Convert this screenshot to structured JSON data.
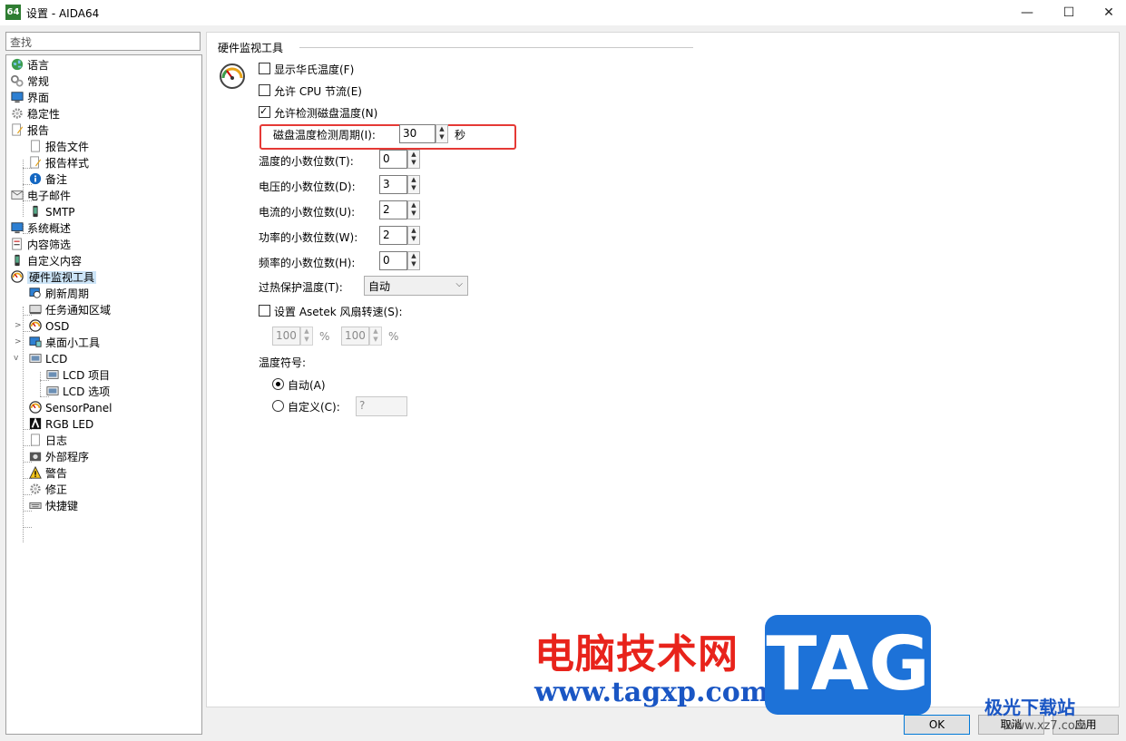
{
  "window": {
    "app_icon_text": "64",
    "title": "设置 - AIDA64",
    "minimize": "—",
    "maximize": "☐",
    "close": "✕"
  },
  "search": {
    "value": "查找"
  },
  "tree": [
    {
      "label": "语言",
      "icon": "globe-icon"
    },
    {
      "label": "常规",
      "icon": "gears-icon"
    },
    {
      "label": "界面",
      "icon": "monitor-icon"
    },
    {
      "label": "稳定性",
      "icon": "gear-icon"
    },
    {
      "label": "报告",
      "icon": "report-icon"
    },
    {
      "label": "报告文件",
      "icon": "document-icon"
    },
    {
      "label": "报告样式",
      "icon": "report-style-icon"
    },
    {
      "label": "备注",
      "icon": "info-icon"
    },
    {
      "label": "电子邮件",
      "icon": "email-icon"
    },
    {
      "label": "SMTP",
      "icon": "phone-icon"
    },
    {
      "label": "系统概述",
      "icon": "monitor-icon"
    },
    {
      "label": "内容筛选",
      "icon": "filter-icon"
    },
    {
      "label": "自定义内容",
      "icon": "phone-icon"
    },
    {
      "label": "硬件监视工具",
      "icon": "gauge-icon"
    },
    {
      "label": "刷新周期",
      "icon": "refresh-icon"
    },
    {
      "label": "任务通知区域",
      "icon": "taskbar-icon"
    },
    {
      "label": "OSD",
      "icon": "gauge-icon"
    },
    {
      "label": "桌面小工具",
      "icon": "gadget-icon"
    },
    {
      "label": "LCD",
      "icon": "lcd-icon"
    },
    {
      "label": "LCD 项目",
      "icon": "lcd-icon"
    },
    {
      "label": "LCD 选项",
      "icon": "lcd-icon"
    },
    {
      "label": "SensorPanel",
      "icon": "gauge-icon"
    },
    {
      "label": "RGB LED",
      "icon": "rgb-icon"
    },
    {
      "label": "日志",
      "icon": "document-icon"
    },
    {
      "label": "外部程序",
      "icon": "program-icon"
    },
    {
      "label": "警告",
      "icon": "warning-icon"
    },
    {
      "label": "修正",
      "icon": "gear-icon"
    },
    {
      "label": "快捷键",
      "icon": "keyboard-icon"
    }
  ],
  "panel": {
    "section_title": "硬件监视工具",
    "show_fahrenheit": "显示华氏温度(F)",
    "allow_cpu_throttle": "允许 CPU 节流(E)",
    "allow_disk_temp": "允许检测磁盘温度(N)",
    "disk_period_label": "磁盘温度检测周期(I):",
    "disk_period_value": "30",
    "disk_period_unit": "秒",
    "temp_decimals_label": "温度的小数位数(T):",
    "temp_decimals_value": "0",
    "voltage_decimals_label": "电压的小数位数(D):",
    "voltage_decimals_value": "3",
    "current_decimals_label": "电流的小数位数(U):",
    "current_decimals_value": "2",
    "power_decimals_label": "功率的小数位数(W):",
    "power_decimals_value": "2",
    "freq_decimals_label": "频率的小数位数(H):",
    "freq_decimals_value": "0",
    "overheat_label": "过热保护温度(T):",
    "overheat_value": "自动",
    "asetek_label": "设置 Asetek 风扇转速(S):",
    "asetek_value1": "100",
    "asetek_value2": "100",
    "percent": "%",
    "temp_symbol_label": "温度符号:",
    "radio_auto": "自动(A)",
    "radio_custom": "自定义(C):",
    "custom_value": "?"
  },
  "buttons": {
    "ok": "OK",
    "cancel": "取消",
    "apply": "应用"
  },
  "watermark": {
    "cn": "电脑技术网",
    "url": "www.tagxp.com",
    "tag": "TAG",
    "jg": "极光下载站",
    "jg_url": "www.xz7.com"
  }
}
